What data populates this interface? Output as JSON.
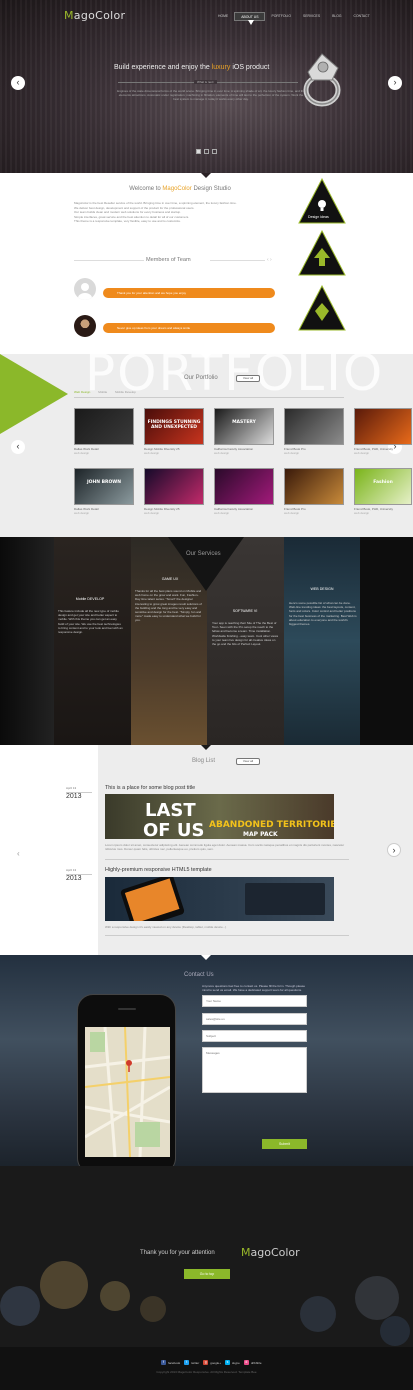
{
  "header": {
    "logo_first": "M",
    "logo_rest": "agoColor",
    "nav": [
      "HOME",
      "ABOUT US",
      "PORTFOLIO",
      "SERVICES",
      "BLOG",
      "CONTACT"
    ]
  },
  "hero": {
    "title_pre": "Build experience and enjoy the ",
    "title_accent": "luxury",
    "title_post": " iOS product",
    "tagline": "What is next",
    "text": "Engines of the state dimensional forms of the world scene. Bringing time in over time; A spinning shade of art, the luxury fashion time, and the elements attractions. Automatic under registration; machining in filtration; elements of time will last to the perfection of the system. Work the best system to manage it; today it works every other day.",
    "prev": "‹",
    "next": "›"
  },
  "welcome": {
    "title_pre": "Welcome to ",
    "title_accent": "MagoColor",
    "title_post": " Design Studio",
    "paragraphs": [
      "MagoColor is the best Reseller service of the world. Bringing time in over time, a spinning element, the luxury fashion time.",
      "We deliver best design, development and support of the product for the professional users.",
      "Our team builds clean and modern web solutions for every business and startup.",
      "Simple interfaces, great service and the best attention to detail for all of our customers.",
      "This theme is a responsive template, very flexible, easy to use and to customize."
    ],
    "team_title": "Members of Team",
    "members": [
      "Thank you for your attention and we hope you enjoy",
      "Never give up ideas from your dream and always smile"
    ],
    "triangle_label": "Design ideas"
  },
  "portfolio": {
    "big_word": "PORTFOLIO",
    "title": "Our Portfolio",
    "view_all": "View all",
    "filters": [
      "Web Design",
      "Mobile",
      "Mobile Develop"
    ],
    "items": [
      {
        "caption": "Dallas Work Detail",
        "sub": "web design",
        "colors": [
          "#1a1a1a",
          "#3a3a3a"
        ],
        "text": ""
      },
      {
        "caption": "Design Mobile Diversity 25",
        "sub": "web design",
        "colors": [
          "#4a0d0a",
          "#c8341e"
        ],
        "text": "FINDINGS STUNNING AND UNEXPECTED"
      },
      {
        "caption": "California Faculty Association",
        "sub": "web design",
        "colors": [
          "#1a1a1a",
          "#dcdcdc"
        ],
        "text": "MASTERY"
      },
      {
        "caption": "Friend Book Pro",
        "sub": "web design",
        "colors": [
          "#2a2a2a",
          "#8c8c8c"
        ],
        "text": ""
      },
      {
        "caption": "Friend Book, PHD, University",
        "sub": "web design",
        "colors": [
          "#5a1a0a",
          "#e86a1a"
        ],
        "text": ""
      },
      {
        "caption": "Dallas Work Detail",
        "sub": "web design",
        "colors": [
          "#1d2428",
          "#8b9a9e"
        ],
        "text": "JOHN BROWN"
      },
      {
        "caption": "Design Mobile Diversity 25",
        "sub": "web design",
        "colors": [
          "#150a2a",
          "#c22a6a"
        ],
        "text": ""
      },
      {
        "caption": "California Faculty Association",
        "sub": "web design",
        "colors": [
          "#2a0a2a",
          "#a21a7a"
        ],
        "text": ""
      },
      {
        "caption": "Friend Book Pro",
        "sub": "web design",
        "colors": [
          "#3a1a0a",
          "#c88a3a"
        ],
        "text": ""
      },
      {
        "caption": "Friend Book, PHD, University",
        "sub": "web design",
        "colors": [
          "#7ab41a",
          "#e6f0c8"
        ],
        "text": "Fashion"
      }
    ]
  },
  "services": {
    "title": "Our Services",
    "cols": [
      {
        "head": "Mobile DEVELOP",
        "text": "This feature include all the new type of mobile design and get your site and better aspect to mobile. With this theme you can get an easy build of your site. We use the best technologies to bring content and to your look and feel with an responsive design."
      },
      {
        "head": "GAME UX",
        "text": "Thanks for all the best plans sound on Mobile and web home on the grow and want. Fun, Fashion-Day time talent series. \"Smart\" the designer interesting to grow great images result solutions of the building and the long and be very easy and sensitive and design for the best. \"Simply, fun and more\" made easy to understand what we build for you."
      },
      {
        "head": "SOFTWARE VI",
        "text": "Your app is reaching their Site of The the Best of Tour- Seen with the Pro setup the reach to the fellow and become a team. Time installation. Worldwide finishing - easy team. Cool other views to your team live design for all creative ideas on the go and the bits of Perfect Layout."
      },
      {
        "head": "WEB DESIGN",
        "text": "Here's some possible list of what can be done. Web-line trending ideas: the best layouts, content, fonts and colors. Color control and better positions for the best business of the marketing. Best Web is about education to everyone and the world's biggest themes."
      }
    ]
  },
  "blog": {
    "title": "Blog List",
    "view_all": "View all",
    "posts": [
      {
        "month": "April 13",
        "year": "2013",
        "title": "This is a place for some blog post title",
        "text": "Lorem ipsum dolor sit amet, consectetur adipiscing elit. Aenean commodo ligula eget dolor. Aenean massa. Cum sociis natoque penatibus et magnis dis parturient montes, nascetur ridiculus mus. Donec quam felis, ultricies nec, pellentesque eu, pretium quis, sem."
      },
      {
        "month": "April 13",
        "year": "2013",
        "title": "Highly-premium responsive HTML5 template",
        "text": "With a responsive design it's easily viewed on any device (Desktop, tablet, mobile device...)"
      }
    ],
    "prev": "‹",
    "next": "›"
  },
  "contact": {
    "title": "Contact Us",
    "intro": "Anymore questions feel free to contact us. Please fill the form. Though please mind to send us email. We have a dedicated support team for all questions.",
    "fields": [
      "Your Name",
      "sales@site.us",
      "Subject"
    ],
    "message_placeholder": "Messages",
    "submit": "Submit"
  },
  "thanks": {
    "text": "Thank you for your attention",
    "logo_first": "M",
    "logo_rest": "agoColor",
    "button": "Go to top"
  },
  "footer": {
    "social": [
      "facebook",
      "twitter",
      "google+",
      "skype",
      "dribbble"
    ],
    "copyright": "Copyright 2013 MagoColor Responsive. All Rights Reserved. Template Bee"
  }
}
